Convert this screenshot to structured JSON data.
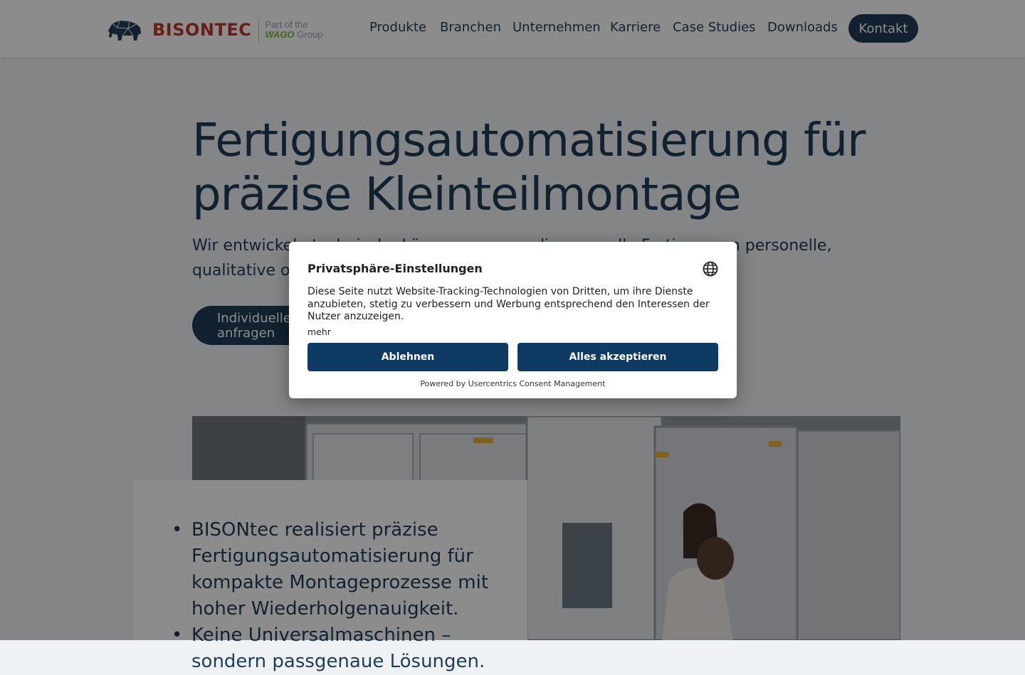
{
  "header": {
    "brand": "BISONTEC",
    "group_line1": "Part of the",
    "group_wago": "WAGO",
    "group_suffix": "Group",
    "logo_icon": "bison-icon",
    "nav": [
      "Produkte",
      "Branchen",
      "Unternehmen",
      "Karriere",
      "Case Studies",
      "Downloads"
    ],
    "contact_label": "Kontakt"
  },
  "hero": {
    "title": "Fertigungsautomatisierung für präzise Kleinteilmontage",
    "subtitle": "Wir entwickeln technische Lösungen, wenn die manuelle Fertigung an personelle, qualitative oder wirtschaftliche Grenzen stößt.",
    "cta_label": "Individuelles Angebot anfragen"
  },
  "bullets": [
    "BISONtec realisiert präzise Fertigungsautomatisierung für kompakte Montageprozesse mit hoher Wiederholgenauigkeit.",
    "Keine Universalmaschinen – sondern passgenaue Lösungen."
  ],
  "consent": {
    "title": "Privatsphäre-Einstellungen",
    "language_icon": "globe-icon",
    "text": "Diese Seite nutzt Website-Tracking-Technologien von Dritten, um ihre Dienste anzubieten, stetig zu verbessern und Werbung entsprechend den Interessen der Nutzer anzuzeigen.",
    "more_label": "mehr",
    "decline_label": "Ablehnen",
    "accept_label": "Alles akzeptieren",
    "powered_by": "Powered by Usercentrics Consent Management"
  },
  "colors": {
    "brand_navy": "#1f3d57",
    "brand_red": "#c0392b",
    "wago_green": "#7ab648",
    "consent_button": "#0d3b63"
  }
}
